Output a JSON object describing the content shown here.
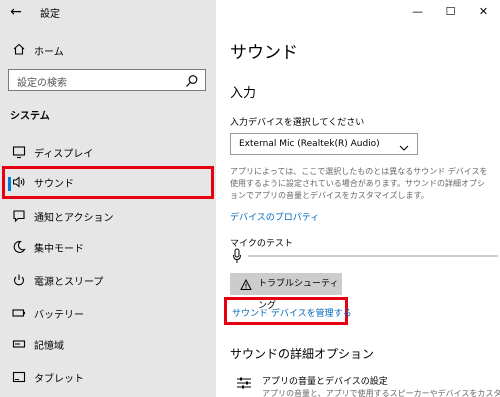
{
  "window": {
    "title": "設定",
    "back": "←",
    "controls": {
      "minimize": "—",
      "maximize": "☐",
      "close": "✕"
    }
  },
  "sidebar": {
    "home_label": "ホーム",
    "search_placeholder": "設定の検索",
    "section_label": "システム",
    "items": [
      {
        "label": "ディスプレイ",
        "icon": "display-icon"
      },
      {
        "label": "サウンド",
        "icon": "speaker-icon",
        "selected": true
      },
      {
        "label": "通知とアクション",
        "icon": "notification-icon"
      },
      {
        "label": "集中モード",
        "icon": "moon-icon"
      },
      {
        "label": "電源とスリープ",
        "icon": "power-icon"
      },
      {
        "label": "バッテリー",
        "icon": "battery-icon"
      },
      {
        "label": "記憶域",
        "icon": "storage-icon"
      },
      {
        "label": "タブレット",
        "icon": "tablet-icon"
      }
    ]
  },
  "main": {
    "title": "サウンド",
    "input_heading": "入力",
    "select_label": "入力デバイスを選択してください",
    "selected_device": "External Mic (Realtek(R) Audio)",
    "description": "アプリによっては、ここで選択したものとは異なるサウンド デバイスを使用するように設定されている場合があります。サウンドの詳細オプションでアプリの音量とデバイスをカスタマイズします。",
    "properties_link": "デバイスのプロパティ",
    "mic_test_label": "マイクのテスト",
    "troubleshoot_label": "トラブルシューティング",
    "manage_link": "サウンド デバイスを管理する",
    "advanced_heading": "サウンドの詳細オプション",
    "advanced_item_title": "アプリの音量とデバイスの設定",
    "advanced_item_desc": "アプリの音量と、アプリで使用するスピーカーやデバイスをカスタマ"
  },
  "colors": {
    "accent": "#0067b8",
    "selection_indicator": "#0078d7",
    "highlight_box": "#e60012",
    "sidebar_bg": "#e6e6e6"
  }
}
